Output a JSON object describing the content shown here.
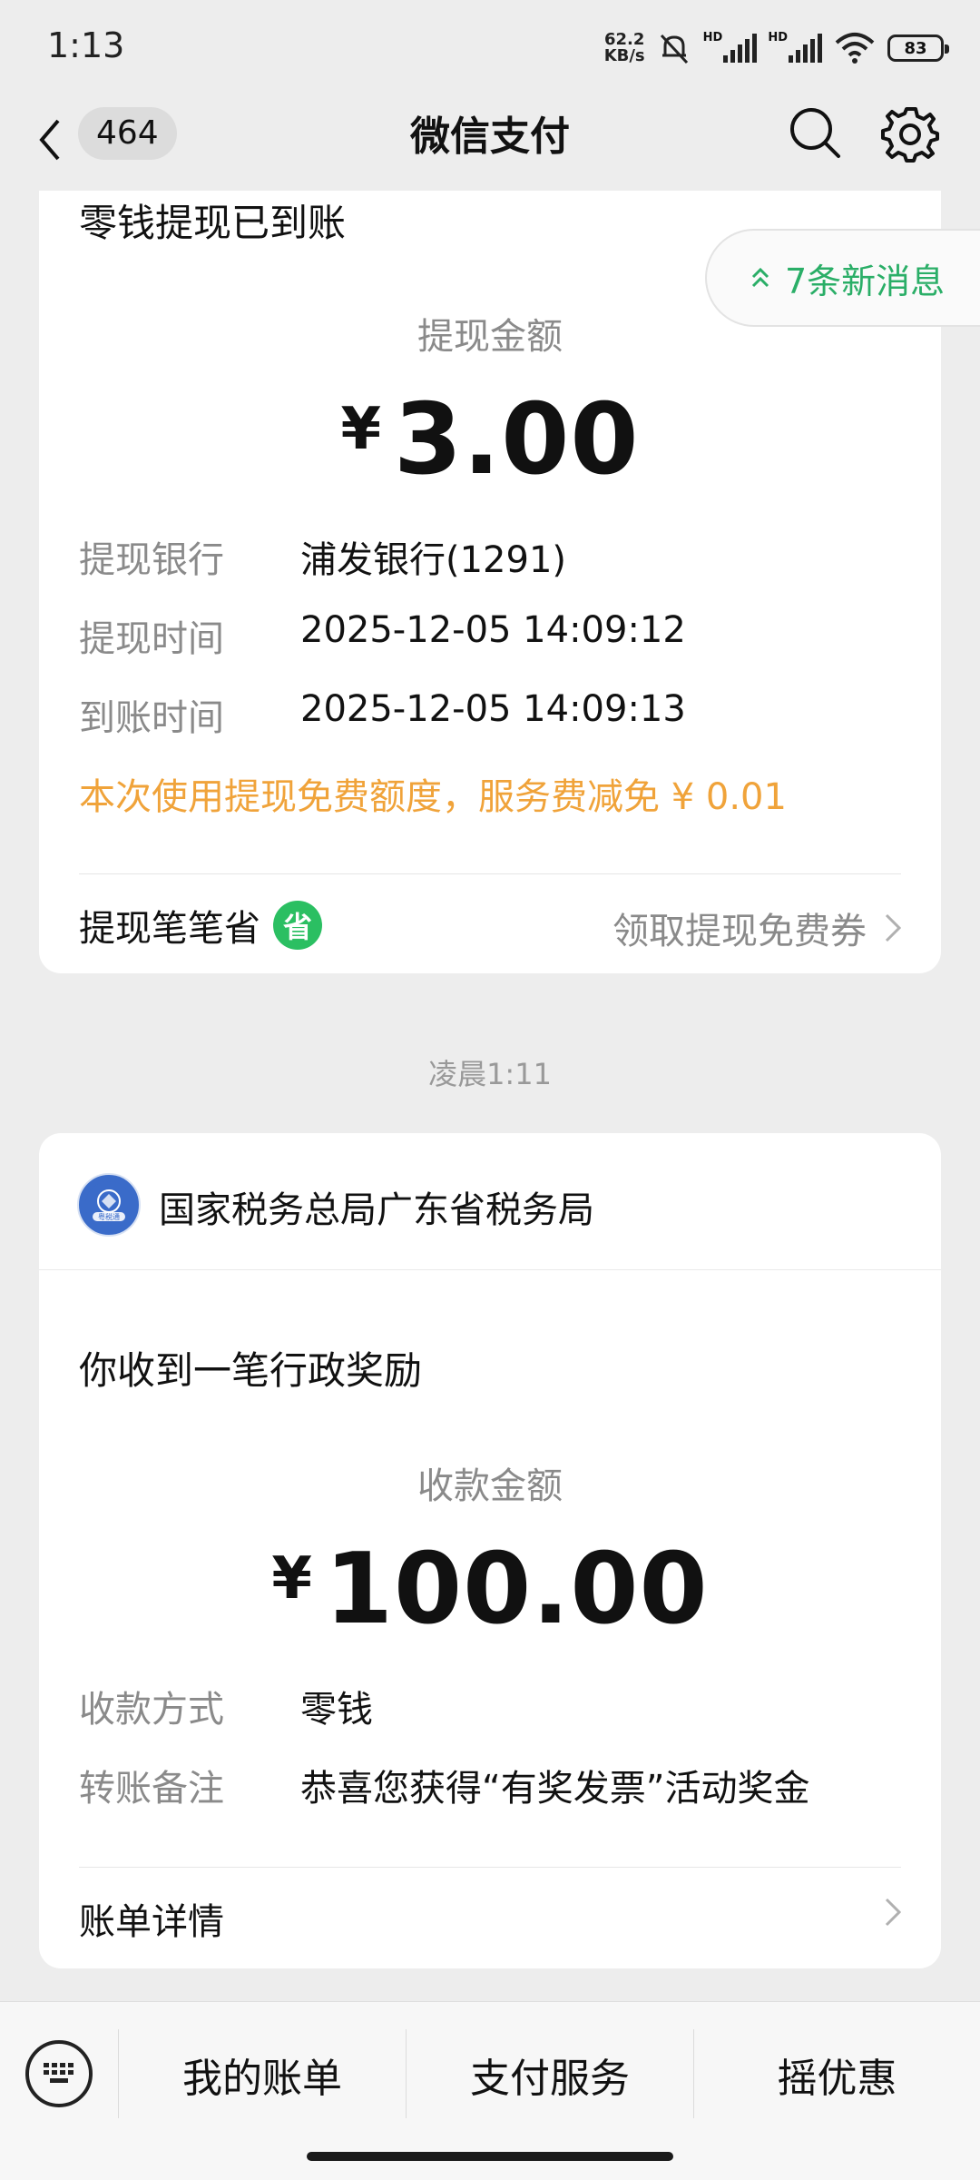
{
  "status": {
    "time": "1:13",
    "speed_value": "62.2",
    "speed_unit": "KB/s",
    "hd_label": "HD",
    "battery": "83"
  },
  "nav": {
    "back_count": "464",
    "title": "微信支付"
  },
  "new_messages": {
    "label": "7条新消息",
    "color": "#2aae67"
  },
  "withdraw_card": {
    "title": "零钱提现已到账",
    "amount_label": "提现金额",
    "currency": "¥",
    "amount": "3.00",
    "rows": [
      {
        "label": "提现银行",
        "value": "浦发银行(1291)"
      },
      {
        "label": "提现时间",
        "value": "2025-12-05 14:09:12"
      },
      {
        "label": "到账时间",
        "value": "2025-12-05 14:09:13"
      }
    ],
    "notice": "本次使用提现免费额度，服务费减免 ¥ 0.01",
    "footer_left": "提现笔笔省",
    "footer_badge": "省",
    "footer_right": "领取提现免费券"
  },
  "time_separator": "凌晨1:11",
  "reward_card": {
    "merchant": "国家税务总局广东省税务局",
    "merchant_logo_text": "粤税通",
    "title": "你收到一笔行政奖励",
    "amount_label": "收款金额",
    "currency": "¥",
    "amount": "100.00",
    "rows": [
      {
        "label": "收款方式",
        "value": "零钱"
      },
      {
        "label": "转账备注",
        "value": "恭喜您获得“有奖发票”活动奖金"
      }
    ],
    "footer_left": "账单详情"
  },
  "bottom_bar": {
    "tabs": [
      "我的账单",
      "支付服务",
      "摇优惠"
    ]
  }
}
